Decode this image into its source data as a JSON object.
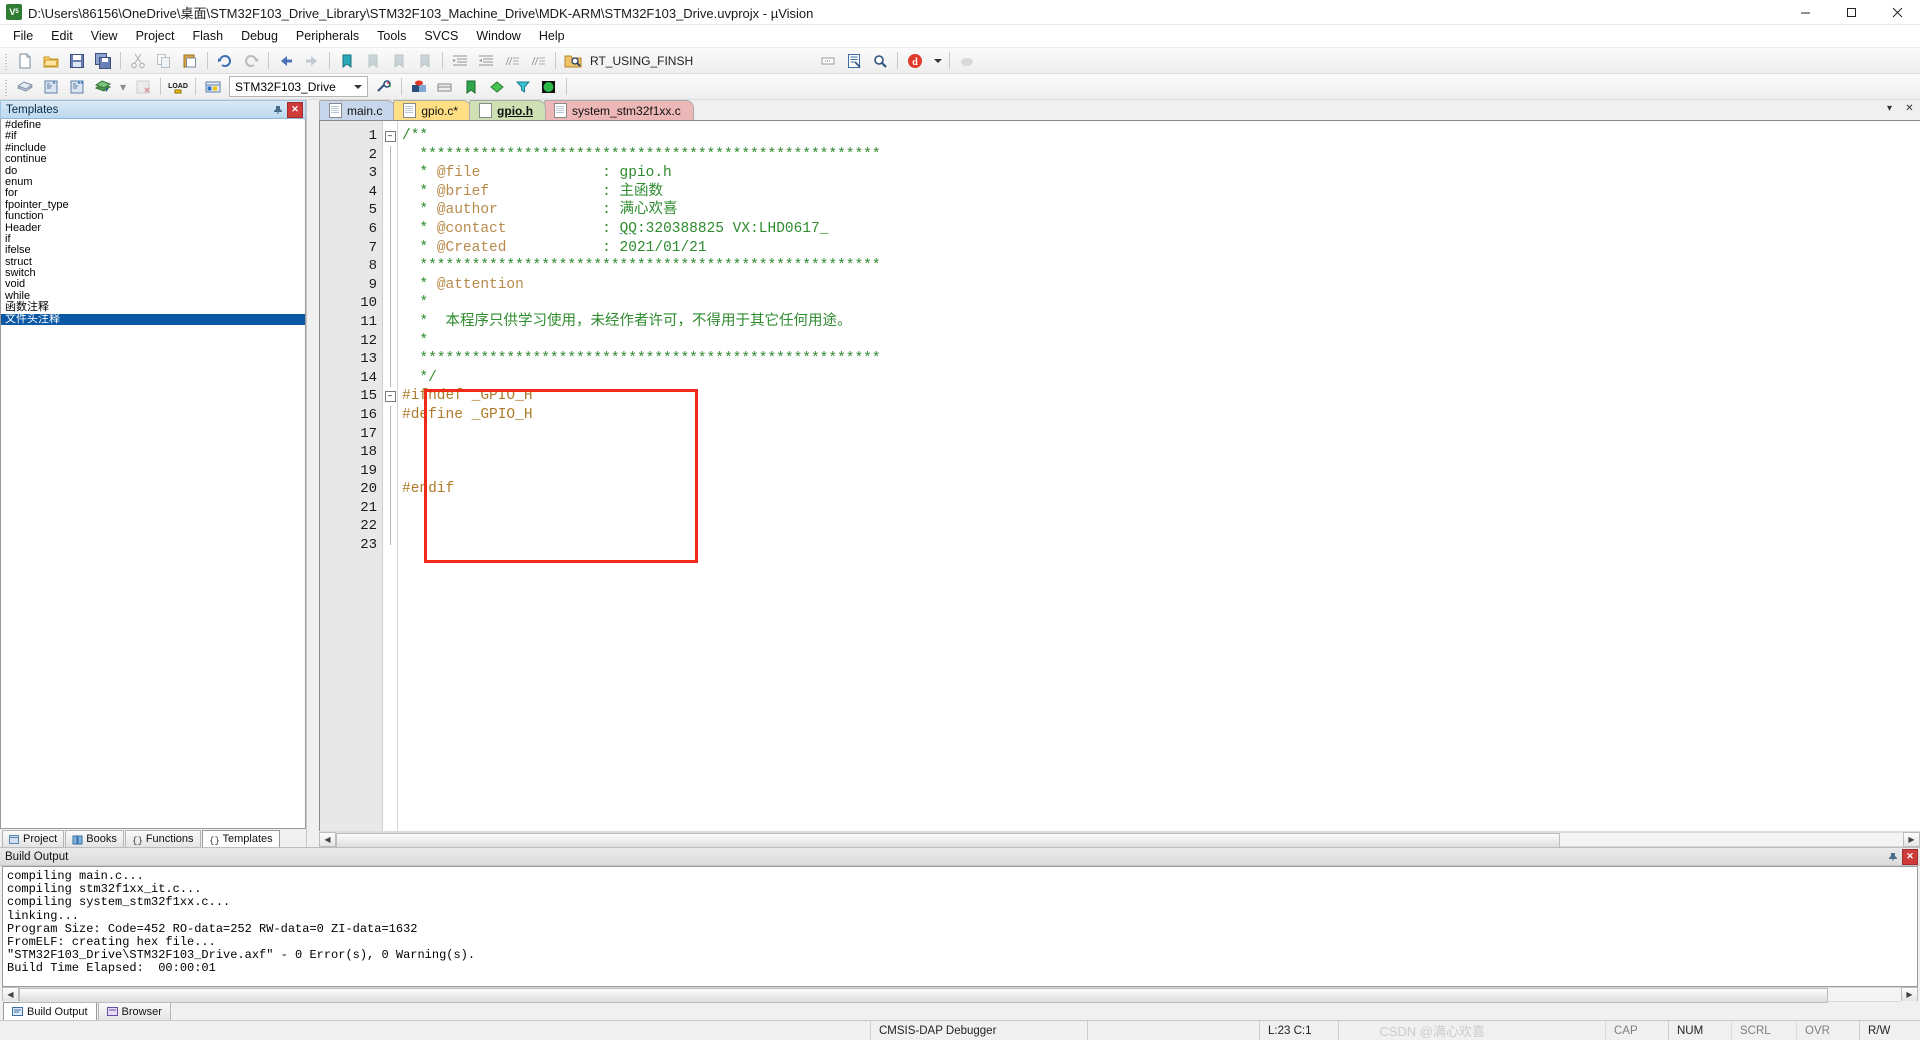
{
  "window": {
    "title": "D:\\Users\\86156\\OneDrive\\桌面\\STM32F103_Drive_Library\\STM32F103_Machine_Drive\\MDK-ARM\\STM32F103_Drive.uvprojx - µVision",
    "app_icon": "uvision-icon",
    "minimize": "–",
    "maximize": "□",
    "close": "✕"
  },
  "menu": {
    "items": [
      {
        "label": "File"
      },
      {
        "label": "Edit"
      },
      {
        "label": "View"
      },
      {
        "label": "Project"
      },
      {
        "label": "Flash"
      },
      {
        "label": "Debug"
      },
      {
        "label": "Peripherals"
      },
      {
        "label": "Tools"
      },
      {
        "label": "SVCS"
      },
      {
        "label": "Window"
      },
      {
        "label": "Help"
      }
    ]
  },
  "toolbar_main": {
    "find_combo_value": "RT_USING_FINSH",
    "buttons": [
      "new-file-icon",
      "open-file-icon",
      "save-icon",
      "save-all-icon",
      "cut-icon",
      "copy-icon",
      "paste-icon",
      "undo-icon",
      "redo-icon",
      "navigate-back-icon",
      "navigate-forward-icon",
      "bookmark-toggle-icon",
      "bookmark-prev-icon",
      "bookmark-next-icon",
      "bookmark-clear-icon",
      "indent-icon",
      "outdent-icon",
      "comment-icon",
      "uncomment-icon",
      "find-in-files-icon",
      "incremental-find-icon",
      "browse-source-icon",
      "find-icon",
      "debug-d-icon",
      "configure-icon"
    ]
  },
  "toolbar_project": {
    "target_combo_value": "STM32F103_Drive",
    "buttons": [
      "translate-icon",
      "build-icon",
      "rebuild-icon",
      "batch-build-icon",
      "stop-build-icon",
      "load-icon",
      "manage-project-items-icon",
      "options-target-icon",
      "start-debug-icon",
      "registers-icon",
      "bookmark-icon",
      "packinstaller-icon"
    ]
  },
  "left_pane": {
    "caption": "Templates",
    "caption_pin": "pin-icon",
    "caption_close": "✕",
    "items": [
      {
        "label": "#define",
        "selected": false
      },
      {
        "label": "#if",
        "selected": false
      },
      {
        "label": "#include",
        "selected": false
      },
      {
        "label": "continue",
        "selected": false
      },
      {
        "label": "do",
        "selected": false
      },
      {
        "label": "enum",
        "selected": false
      },
      {
        "label": "for",
        "selected": false
      },
      {
        "label": "fpointer_type",
        "selected": false
      },
      {
        "label": "function",
        "selected": false
      },
      {
        "label": "Header",
        "selected": false
      },
      {
        "label": "if",
        "selected": false
      },
      {
        "label": "ifelse",
        "selected": false
      },
      {
        "label": "struct",
        "selected": false
      },
      {
        "label": "switch",
        "selected": false
      },
      {
        "label": "void",
        "selected": false
      },
      {
        "label": "while",
        "selected": false
      },
      {
        "label": "函数注释",
        "selected": false
      },
      {
        "label": "文件头注释",
        "selected": true
      }
    ],
    "tabs": [
      {
        "label": "Project",
        "icon": "project-icon",
        "active": false
      },
      {
        "label": "Books",
        "icon": "books-icon",
        "active": false
      },
      {
        "label": "Functions",
        "icon": "functions-icon",
        "active": false
      },
      {
        "label": "Templates",
        "icon": "templates-icon",
        "active": true
      }
    ]
  },
  "editor": {
    "tabs": [
      {
        "label": "main.c",
        "modified": false,
        "active": false,
        "color_class": "t-main"
      },
      {
        "label": "gpio.c*",
        "modified": true,
        "active": false,
        "color_class": "t-gpioc"
      },
      {
        "label": "gpio.h",
        "modified": false,
        "active": true,
        "color_class": "t-gpioh"
      },
      {
        "label": "system_stm32f1xx.c",
        "modified": false,
        "active": false,
        "color_class": "t-sys"
      }
    ],
    "tab_controls": {
      "dropdown": "▾",
      "close": "✕"
    },
    "lines": [
      {
        "n": 1,
        "fold": "minus",
        "segments": [
          {
            "t": "/**",
            "c": "c-cmt"
          }
        ]
      },
      {
        "n": 2,
        "fold": "bar",
        "segments": [
          {
            "t": "  *****************************************************",
            "c": "c-cmt"
          }
        ]
      },
      {
        "n": 3,
        "fold": "bar",
        "segments": [
          {
            "t": "  * ",
            "c": "c-cmt"
          },
          {
            "t": "@file",
            "c": "c-tag"
          },
          {
            "t": "              : gpio.h",
            "c": "c-cmt"
          }
        ]
      },
      {
        "n": 4,
        "fold": "bar",
        "segments": [
          {
            "t": "  * ",
            "c": "c-cmt"
          },
          {
            "t": "@brief",
            "c": "c-tag"
          },
          {
            "t": "             : 主函数",
            "c": "c-cn"
          }
        ]
      },
      {
        "n": 5,
        "fold": "bar",
        "segments": [
          {
            "t": "  * ",
            "c": "c-cmt"
          },
          {
            "t": "@author",
            "c": "c-tag"
          },
          {
            "t": "            : 满心欢喜",
            "c": "c-cn"
          }
        ]
      },
      {
        "n": 6,
        "fold": "bar",
        "segments": [
          {
            "t": "  * ",
            "c": "c-cmt"
          },
          {
            "t": "@contact",
            "c": "c-tag"
          },
          {
            "t": "           : ",
            "c": "c-cmt"
          },
          {
            "t": "QQ",
            "c": "c-qq"
          },
          {
            "t": ":320388825 VX:LHD0617_",
            "c": "c-cmt"
          }
        ]
      },
      {
        "n": 7,
        "fold": "bar",
        "segments": [
          {
            "t": "  * ",
            "c": "c-cmt"
          },
          {
            "t": "@Created",
            "c": "c-tag"
          },
          {
            "t": "           : 2021/01/21",
            "c": "c-cmt"
          }
        ]
      },
      {
        "n": 8,
        "fold": "bar",
        "segments": [
          {
            "t": "  *****************************************************",
            "c": "c-cmt"
          }
        ]
      },
      {
        "n": 9,
        "fold": "bar",
        "segments": [
          {
            "t": "  * ",
            "c": "c-cmt"
          },
          {
            "t": "@attention",
            "c": "c-tag"
          }
        ]
      },
      {
        "n": 10,
        "fold": "bar",
        "segments": [
          {
            "t": "  *",
            "c": "c-cmt"
          }
        ]
      },
      {
        "n": 11,
        "fold": "bar",
        "segments": [
          {
            "t": "  *  本程序只供学习使用，未经作者许可，不得用于其它任何用途。",
            "c": "c-cn"
          }
        ]
      },
      {
        "n": 12,
        "fold": "bar",
        "segments": [
          {
            "t": "  *",
            "c": "c-cmt"
          }
        ]
      },
      {
        "n": 13,
        "fold": "bar",
        "segments": [
          {
            "t": "  *****************************************************",
            "c": "c-cmt"
          }
        ]
      },
      {
        "n": 14,
        "fold": "bar",
        "segments": [
          {
            "t": "  */",
            "c": "c-cmt"
          }
        ]
      },
      {
        "n": 15,
        "fold": "minus",
        "segments": [
          {
            "t": "#ifndef _GPIO_H",
            "c": "c-pp"
          }
        ]
      },
      {
        "n": 16,
        "fold": "bar",
        "segments": [
          {
            "t": "#define _GPIO_H",
            "c": "c-pp"
          }
        ]
      },
      {
        "n": 17,
        "fold": "bar",
        "segments": [
          {
            "t": "",
            "c": "c-pp"
          }
        ]
      },
      {
        "n": 18,
        "fold": "bar",
        "segments": [
          {
            "t": "",
            "c": "c-pp"
          }
        ]
      },
      {
        "n": 19,
        "fold": "bar",
        "segments": [
          {
            "t": "",
            "c": "c-pp"
          }
        ]
      },
      {
        "n": 20,
        "fold": "bar",
        "segments": [
          {
            "t": "#endif",
            "c": "c-pp"
          }
        ]
      },
      {
        "n": 21,
        "fold": "bar",
        "segments": [
          {
            "t": "",
            "c": "c-pp"
          }
        ]
      },
      {
        "n": 22,
        "fold": "bar",
        "segments": [
          {
            "t": "",
            "c": "c-pp"
          }
        ]
      },
      {
        "n": 23,
        "fold": "end",
        "segments": [
          {
            "t": "",
            "c": "c-pp"
          }
        ]
      }
    ],
    "highlight_box": {
      "color": "#f12a17",
      "label": "include-guard-highlight"
    }
  },
  "build_output": {
    "caption": "Build Output",
    "caption_pin": "pin-icon",
    "caption_close": "✕",
    "lines": [
      "compiling main.c...",
      "compiling stm32f1xx_it.c...",
      "compiling system_stm32f1xx.c...",
      "linking...",
      "Program Size: Code=452 RO-data=252 RW-data=0 ZI-data=1632",
      "FromELF: creating hex file...",
      "\"STM32F103_Drive\\STM32F103_Drive.axf\" - 0 Error(s), 0 Warning(s).",
      "Build Time Elapsed:  00:00:01"
    ],
    "tabs": [
      {
        "label": "Build Output",
        "icon": "build-output-icon",
        "active": true
      },
      {
        "label": "Browser",
        "icon": "browser-icon",
        "active": false
      }
    ]
  },
  "statusbar": {
    "debugger": "CMSIS-DAP Debugger",
    "cursor": "L:23 C:1",
    "caps": "CAP",
    "num": "NUM",
    "scrl": "SCRL",
    "ovr": "OVR",
    "rw": "R/W",
    "watermark": "CSDN @满心欢喜"
  }
}
